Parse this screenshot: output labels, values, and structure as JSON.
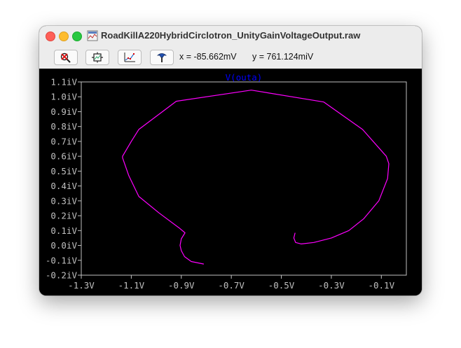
{
  "window": {
    "title": "RoadKillA220HybridCirclotron_UnityGainVoltageOutput.raw"
  },
  "toolbar": {
    "buttons": [
      {
        "name": "zoom-cancel-icon"
      },
      {
        "name": "autorange-icon"
      },
      {
        "name": "mark-data-points-icon"
      },
      {
        "name": "cursor-probe-icon"
      }
    ],
    "x_readout": "x = -85.662mV",
    "y_readout": "y = 761.124miV"
  },
  "colors": {
    "trace": "#ff00ff",
    "trace_label": "#0000ff",
    "axis": "#c0c0c0",
    "background": "#000000"
  },
  "chart_data": {
    "type": "line",
    "title": "",
    "xlabel": "",
    "ylabel": "",
    "xlim": [
      -1.3,
      0.0
    ],
    "ylim": [
      -0.2,
      1.1
    ],
    "x_tick_labels": [
      "-1.3V",
      "-1.1V",
      "-0.9V",
      "-0.7V",
      "-0.5V",
      "-0.3V",
      "-0.1V"
    ],
    "x_tick_values": [
      -1.3,
      -1.1,
      -0.9,
      -0.7,
      -0.5,
      -0.3,
      -0.1
    ],
    "y_tick_labels": [
      "1.1iV",
      "1.0iV",
      "0.9iV",
      "0.8iV",
      "0.7iV",
      "0.6iV",
      "0.5iV",
      "0.4iV",
      "0.3iV",
      "0.2iV",
      "0.1iV",
      "0.0iV",
      "-0.1iV",
      "-0.2iV"
    ],
    "y_tick_values": [
      1.1,
      1.0,
      0.9,
      0.8,
      0.7,
      0.6,
      0.5,
      0.4,
      0.3,
      0.2,
      0.1,
      0.0,
      -0.1,
      -0.2
    ],
    "grid": false,
    "series": [
      {
        "name": "V(outa)",
        "x": [
          -0.81,
          -0.86,
          -0.887,
          -0.9,
          -0.905,
          -0.9,
          -0.885,
          -0.91,
          -0.99,
          -1.07,
          -1.11,
          -1.135,
          -1.135,
          -1.1,
          -1.07,
          -0.92,
          -0.62,
          -0.33,
          -0.175,
          -0.08,
          -0.07,
          -0.075,
          -0.11,
          -0.17,
          -0.23,
          -0.3,
          -0.37,
          -0.42,
          -0.443,
          -0.45,
          -0.445
        ],
        "y": [
          -0.125,
          -0.108,
          -0.075,
          -0.035,
          0.0,
          0.045,
          0.085,
          0.12,
          0.22,
          0.33,
          0.47,
          0.59,
          0.6,
          0.7,
          0.78,
          0.97,
          1.045,
          0.965,
          0.78,
          0.6,
          0.55,
          0.45,
          0.3,
          0.18,
          0.1,
          0.05,
          0.02,
          0.01,
          0.02,
          0.05,
          0.085
        ]
      }
    ]
  }
}
